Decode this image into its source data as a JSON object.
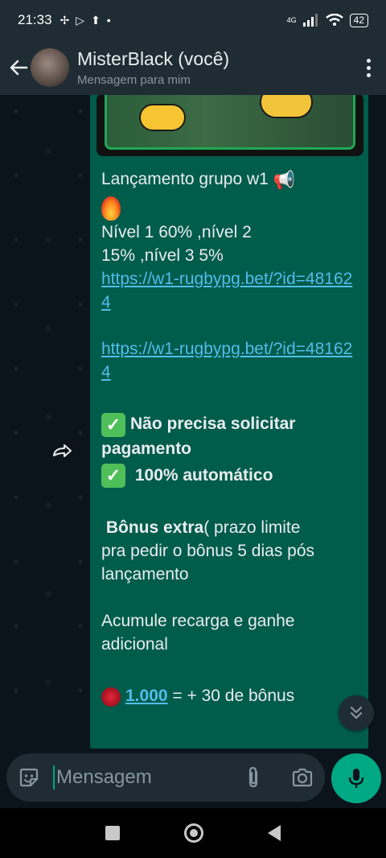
{
  "status_bar": {
    "time": "21:33",
    "network": "4G",
    "battery": "42"
  },
  "header": {
    "title": "MisterBlack (você)",
    "subtitle": "Mensagem para mim"
  },
  "message": {
    "line_title": "Lançamento grupo w1",
    "levels_line1": "Nível 1 60% ,nível 2",
    "levels_line2": "15% ,nível 3 5%",
    "link1": "https://w1-rugbypg.bet/?id=481624",
    "link2": "https://w1-rugbypg.bet/?id=481624",
    "feature1_line1": "Não  precisa solicitar",
    "feature1_line2": "pagamento",
    "feature2": " 100% automático",
    "bonus_bold": "Bônus extra",
    "bonus_rest_line1": "( prazo limite",
    "bonus_line2": "pra pedir o bônus 5 dias pós",
    "bonus_line3": "lançamento",
    "accumulate_line1": "Acumule  recarga  e ganhe",
    "accumulate_line2": "adicional",
    "tier1_amount": "1.000",
    "tier1_reward": " = + 30 de bônus"
  },
  "input": {
    "placeholder": "Mensagem"
  },
  "colors": {
    "bubble": "#005c4b",
    "accent": "#00a884",
    "link": "#53bdeb",
    "header": "#1f2c34"
  },
  "icons": [
    "back-arrow-icon",
    "more-vert-icon",
    "forward-icon",
    "sticker-icon",
    "attach-icon",
    "camera-icon",
    "mic-icon",
    "chevrons-down-icon"
  ]
}
